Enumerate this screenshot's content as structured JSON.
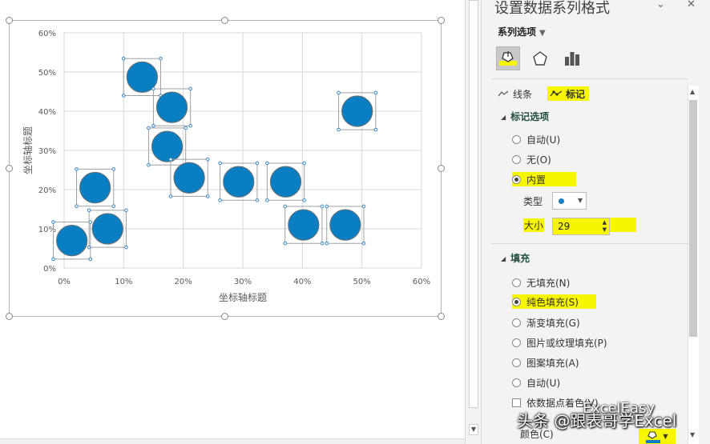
{
  "pane": {
    "title": "设置数据系列格式",
    "series_options_label": "系列选项",
    "subtabs": {
      "line": "线条",
      "marker": "标记"
    },
    "marker_options": {
      "header": "标记选项",
      "auto": "自动(U)",
      "none": "无(O)",
      "builtin": "内置",
      "selected": "内置",
      "type_label": "类型",
      "size_label": "大小",
      "size_value": "29"
    },
    "fill": {
      "header": "填充",
      "no_fill": "无填充(N)",
      "solid_fill": "纯色填充(S)",
      "gradient_fill": "渐变填充(G)",
      "picture_fill": "图片或纹理填充(P)",
      "pattern_fill": "图案填充(A)",
      "auto": "自动(U)",
      "vary_by_point": "依数据点着色(V)",
      "selected": "纯色填充(S)",
      "color_label": "颜色(C)"
    },
    "watermark": "头条 @跟表哥学Excel",
    "watermark2": "ExcelEasy"
  },
  "colors": {
    "marker_fill": "#0a7ec2",
    "highlight": "#f7f500"
  },
  "chart_data": {
    "type": "scatter",
    "xlabel": "坐标轴标题",
    "ylabel": "坐标轴标题",
    "xlim": [
      0,
      0.6
    ],
    "ylim": [
      0,
      0.6
    ],
    "xticks": [
      "0%",
      "10%",
      "20%",
      "30%",
      "40%",
      "50%",
      "60%"
    ],
    "yticks": [
      "0%",
      "10%",
      "20%",
      "30%",
      "40%",
      "50%",
      "60%"
    ],
    "grid": true,
    "marker": "circle",
    "marker_size": 29,
    "points": [
      {
        "x": 0.013,
        "y": 0.07
      },
      {
        "x": 0.052,
        "y": 0.205
      },
      {
        "x": 0.073,
        "y": 0.1
      },
      {
        "x": 0.131,
        "y": 0.487
      },
      {
        "x": 0.181,
        "y": 0.41
      },
      {
        "x": 0.173,
        "y": 0.31
      },
      {
        "x": 0.21,
        "y": 0.23
      },
      {
        "x": 0.293,
        "y": 0.22
      },
      {
        "x": 0.372,
        "y": 0.22
      },
      {
        "x": 0.402,
        "y": 0.11
      },
      {
        "x": 0.472,
        "y": 0.11
      },
      {
        "x": 0.492,
        "y": 0.4
      }
    ]
  }
}
